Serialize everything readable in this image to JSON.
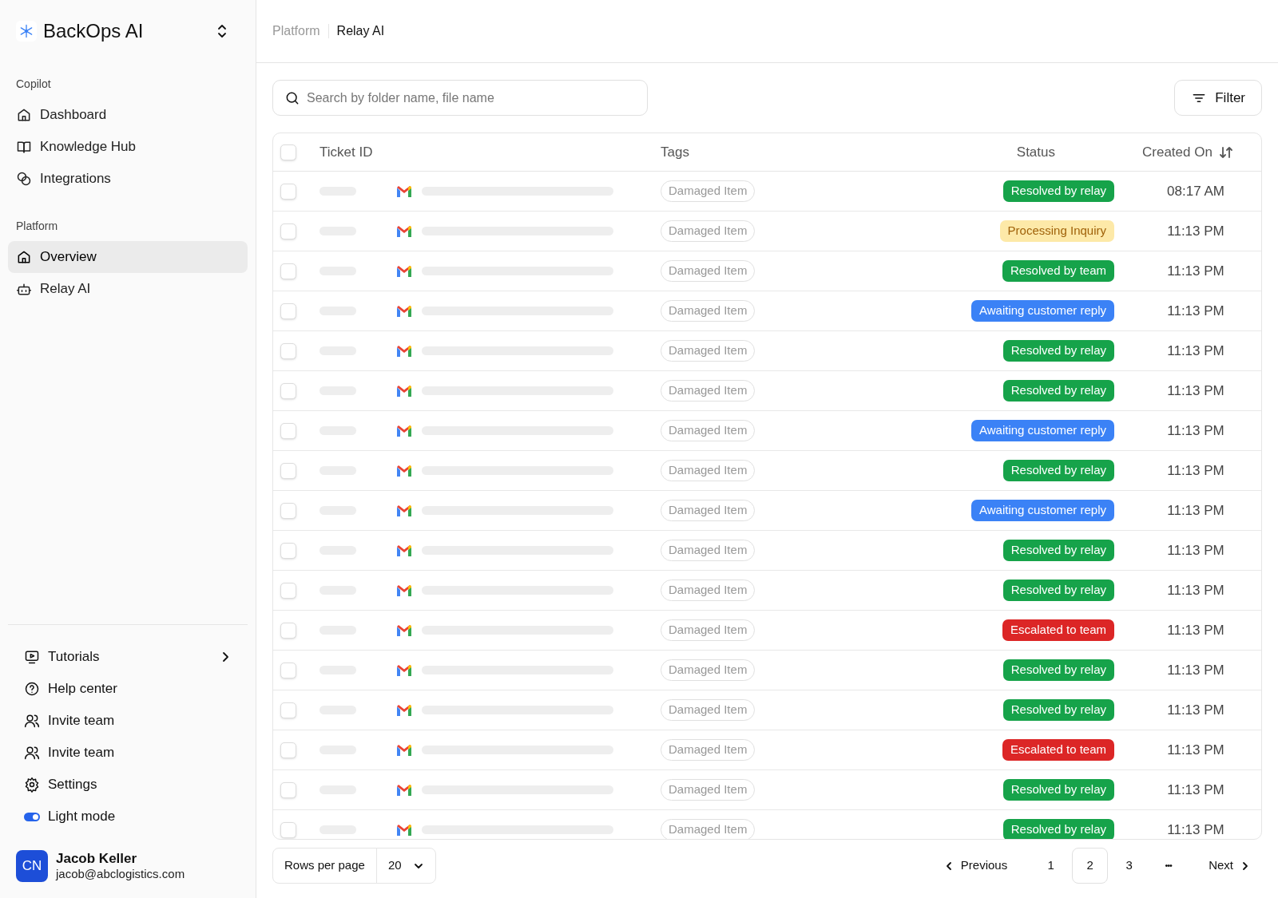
{
  "brand": {
    "name": "BackOps AI"
  },
  "sidebar": {
    "sections": [
      {
        "title": "Copilot",
        "items": [
          {
            "label": "Dashboard",
            "selected": false
          },
          {
            "label": "Knowledge Hub",
            "selected": false
          },
          {
            "label": "Integrations",
            "selected": false
          }
        ]
      },
      {
        "title": "Platform",
        "items": [
          {
            "label": "Overview",
            "selected": true
          },
          {
            "label": "Relay AI",
            "selected": false
          }
        ]
      }
    ],
    "footer_items": [
      {
        "label": "Tutorials",
        "kind": "submenu"
      },
      {
        "label": "Help center",
        "kind": "link"
      },
      {
        "label": "Invite team",
        "kind": "link"
      },
      {
        "label": "Invite team",
        "kind": "link"
      },
      {
        "label": "Settings",
        "kind": "link"
      },
      {
        "label": "Light mode",
        "kind": "toggle",
        "on": true
      }
    ],
    "user": {
      "initials": "CN",
      "name": "Jacob Keller",
      "email": "jacob@abclogistics.com"
    }
  },
  "breadcrumb": [
    "Platform",
    "Relay AI"
  ],
  "search": {
    "placeholder": "Search by folder name, file name"
  },
  "filter_button": "Filter",
  "table": {
    "header_checked": false,
    "columns": [
      "Ticket ID",
      "Tags",
      "Status",
      "Created On"
    ],
    "rows": [
      {
        "checked": false,
        "tag": "Damaged Item",
        "status": "Resolved by relay",
        "kind": "resolved",
        "created": "08:17 AM"
      },
      {
        "checked": false,
        "tag": "Damaged Item",
        "status": "Processing Inquiry",
        "kind": "processing",
        "created": "11:13 PM"
      },
      {
        "checked": false,
        "tag": "Damaged Item",
        "status": "Resolved by team",
        "kind": "resolved",
        "created": "11:13 PM"
      },
      {
        "checked": false,
        "tag": "Damaged Item",
        "status": "Awaiting customer reply",
        "kind": "awaiting",
        "created": "11:13 PM"
      },
      {
        "checked": false,
        "tag": "Damaged Item",
        "status": "Resolved by relay",
        "kind": "resolved",
        "created": "11:13 PM"
      },
      {
        "checked": false,
        "tag": "Damaged Item",
        "status": "Resolved by relay",
        "kind": "resolved",
        "created": "11:13 PM"
      },
      {
        "checked": false,
        "tag": "Damaged Item",
        "status": "Awaiting customer reply",
        "kind": "awaiting",
        "created": "11:13 PM"
      },
      {
        "checked": false,
        "tag": "Damaged Item",
        "status": "Resolved by relay",
        "kind": "resolved",
        "created": "11:13 PM"
      },
      {
        "checked": false,
        "tag": "Damaged Item",
        "status": "Awaiting customer reply",
        "kind": "awaiting",
        "created": "11:13 PM"
      },
      {
        "checked": false,
        "tag": "Damaged Item",
        "status": "Resolved by relay",
        "kind": "resolved",
        "created": "11:13 PM"
      },
      {
        "checked": false,
        "tag": "Damaged Item",
        "status": "Resolved by relay",
        "kind": "resolved",
        "created": "11:13 PM"
      },
      {
        "checked": false,
        "tag": "Damaged Item",
        "status": "Escalated to team",
        "kind": "escalated",
        "created": "11:13 PM"
      },
      {
        "checked": false,
        "tag": "Damaged Item",
        "status": "Resolved by relay",
        "kind": "resolved",
        "created": "11:13 PM"
      },
      {
        "checked": false,
        "tag": "Damaged Item",
        "status": "Resolved by relay",
        "kind": "resolved",
        "created": "11:13 PM"
      },
      {
        "checked": false,
        "tag": "Damaged Item",
        "status": "Escalated to team",
        "kind": "escalated",
        "created": "11:13 PM"
      },
      {
        "checked": false,
        "tag": "Damaged Item",
        "status": "Resolved by relay",
        "kind": "resolved",
        "created": "11:13 PM"
      },
      {
        "checked": false,
        "tag": "Damaged Item",
        "status": "Resolved by relay",
        "kind": "resolved",
        "created": "11:13 PM"
      }
    ]
  },
  "pagination": {
    "rows_per_page_label": "Rows per page",
    "rows_per_page": "20",
    "previous": "Previous",
    "next": "Next",
    "pages": [
      {
        "label": "1",
        "selected": false
      },
      {
        "label": "2",
        "selected": true
      },
      {
        "label": "3",
        "selected": false
      }
    ],
    "ellipsis": "•••"
  }
}
